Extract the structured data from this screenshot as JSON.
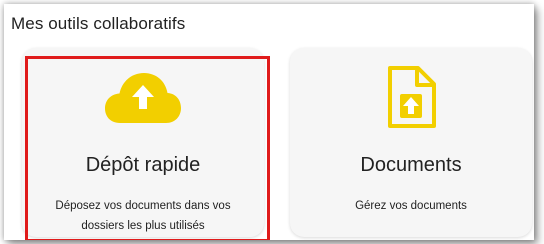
{
  "section": {
    "title": "Mes outils collaboratifs"
  },
  "cards": [
    {
      "title": "Dépôt rapide",
      "description": "Déposez vos documents dans vos dossiers les plus utilisés",
      "icon": "cloud-upload-icon",
      "highlighted": true
    },
    {
      "title": "Documents",
      "description": "Gérez vos documents",
      "icon": "document-upload-icon",
      "highlighted": false
    }
  ],
  "colors": {
    "icon_accent": "#f2cf00",
    "highlight_border": "#e01b1b",
    "card_background": "#f6f6f6"
  }
}
